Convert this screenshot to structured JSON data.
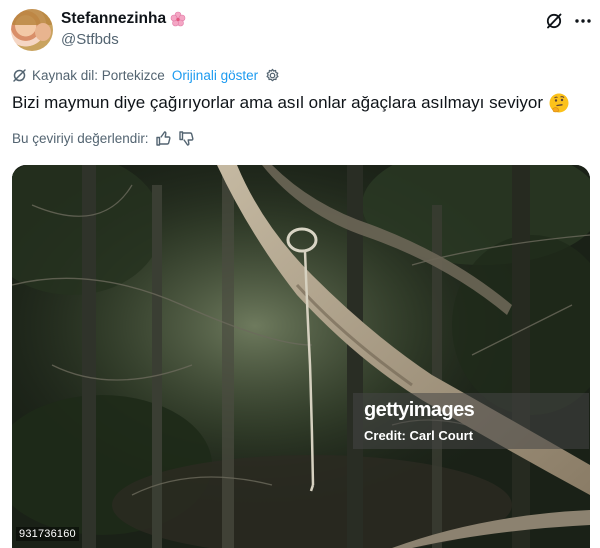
{
  "author": {
    "display_name": "Stefannezinha",
    "handle": "@Stfbds",
    "name_emoji_icon": "cherry-blossom-icon",
    "avatar_icon": "avatar"
  },
  "header_icons": [
    "grok-icon",
    "more-icon"
  ],
  "translation": {
    "source_language": "Kaynak dil: Portekizce",
    "show_original": "Orijinali göster",
    "settings_icon": "gear-icon"
  },
  "tweet": {
    "text": "Bizi maymun diye çağırıyorlar ama asıl onlar ağaçlara asılmayı seviyor",
    "emoji_icon": "thinking-face-icon"
  },
  "rate": {
    "label": "Bu çeviriyi değerlendir:",
    "icons": [
      "thumbs-up-icon",
      "thumbs-down-icon"
    ]
  },
  "photo": {
    "watermark_logo": "gettyimages",
    "credit": "Credit: Carl Court",
    "image_id": "931736160"
  },
  "colors": {
    "text": "#0f1419",
    "secondary": "#536471",
    "link": "#1d9bf0"
  }
}
